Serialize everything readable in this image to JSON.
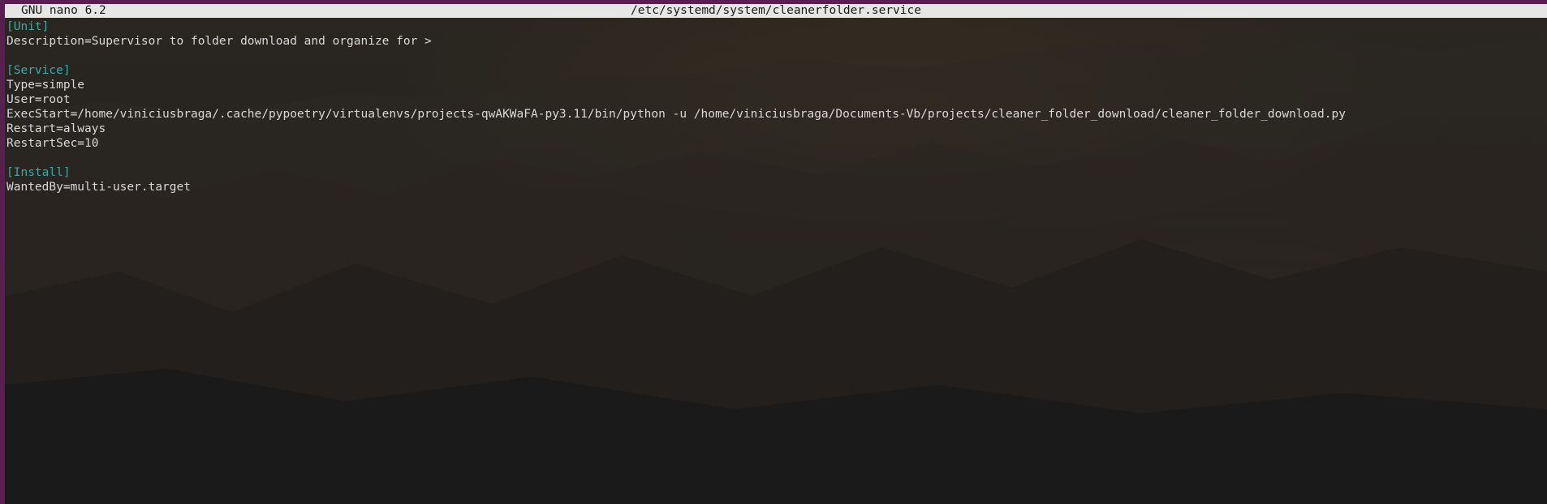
{
  "titlebar": {
    "app": "GNU nano 6.2",
    "filename": "/etc/systemd/system/cleanerfolder.service"
  },
  "editor": {
    "lines": [
      {
        "text": "[Unit]",
        "kind": "section"
      },
      {
        "text": "Description=Supervisor to folder download and organize for >",
        "kind": "text"
      },
      {
        "text": "",
        "kind": "blank"
      },
      {
        "text": "[Service]",
        "kind": "section"
      },
      {
        "text": "Type=simple",
        "kind": "text"
      },
      {
        "text": "User=root",
        "kind": "text"
      },
      {
        "text": "ExecStart=/home/viniciusbraga/.cache/pypoetry/virtualenvs/projects-qwAKWaFA-py3.11/bin/python -u /home/viniciusbraga/Documents-Vb/projects/cleaner_folder_download/cleaner_folder_download.py",
        "kind": "text"
      },
      {
        "text": "Restart=always",
        "kind": "text"
      },
      {
        "text": "RestartSec=10",
        "kind": "text"
      },
      {
        "text": "",
        "kind": "blank"
      },
      {
        "text": "[Install]",
        "kind": "section"
      },
      {
        "text": "WantedBy=multi-user.target",
        "kind": "text"
      }
    ]
  },
  "colors": {
    "section_header": "#3fa7a6",
    "text": "#d8d8d8",
    "titlebar_bg": "#e6e6e6",
    "window_border": "#5a1e52"
  }
}
